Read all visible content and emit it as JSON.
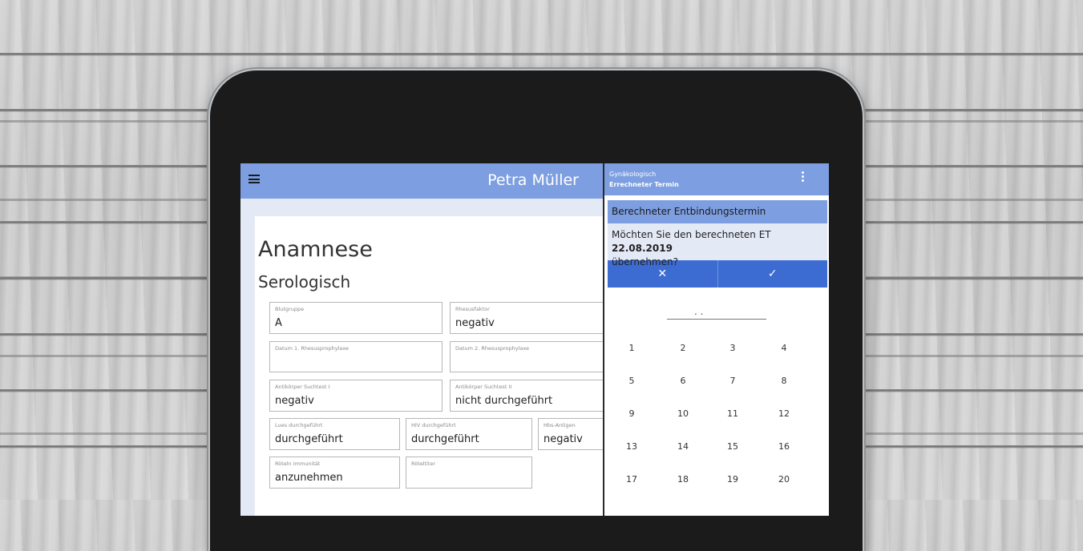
{
  "app": {
    "patient_name": "Petra Müller",
    "menu_icon": "hamburger-menu-icon"
  },
  "form": {
    "title": "Anamnese",
    "section": "Serologisch",
    "fields": [
      {
        "label": "Blutgruppe",
        "value": "A"
      },
      {
        "label": "Rhesusfaktor",
        "value": "negativ"
      },
      {
        "label": "Datum 1. Rhesusprophylaxe",
        "value": ""
      },
      {
        "label": "Datum 2. Rhesusprophylaxe",
        "value": ""
      },
      {
        "label": "Antikörper Suchtest I",
        "value": "negativ"
      },
      {
        "label": "Antikörper Suchtest II",
        "value": "nicht durchgeführt"
      },
      {
        "label": "Lues durchgeführt",
        "value": "durchgeführt"
      },
      {
        "label": "HIV durchgeführt",
        "value": "durchgeführt"
      },
      {
        "label": "Hbs-Antigen",
        "value": "negativ"
      },
      {
        "label": "Röteln Immunität",
        "value": "anzunehmen"
      },
      {
        "label": "Röteltiter",
        "value": ""
      }
    ]
  },
  "panel": {
    "subtitle": "Gynäkologisch",
    "title": "Errechneter Termin",
    "more_icon": "more-vertical-icon",
    "dialog": {
      "heading": "Berechneter Entbindungstermin",
      "message_prefix": "Möchten Sie den berechneten ET ",
      "date": "22.08.2019",
      "message_suffix": "übernehmen?",
      "cancel_glyph": "✕",
      "confirm_glyph": "✓"
    },
    "date_input_dots": ". .",
    "numbers": [
      "1",
      "2",
      "3",
      "4",
      "5",
      "6",
      "7",
      "8",
      "9",
      "10",
      "11",
      "12",
      "13",
      "14",
      "15",
      "16",
      "17",
      "18",
      "19",
      "20"
    ]
  }
}
